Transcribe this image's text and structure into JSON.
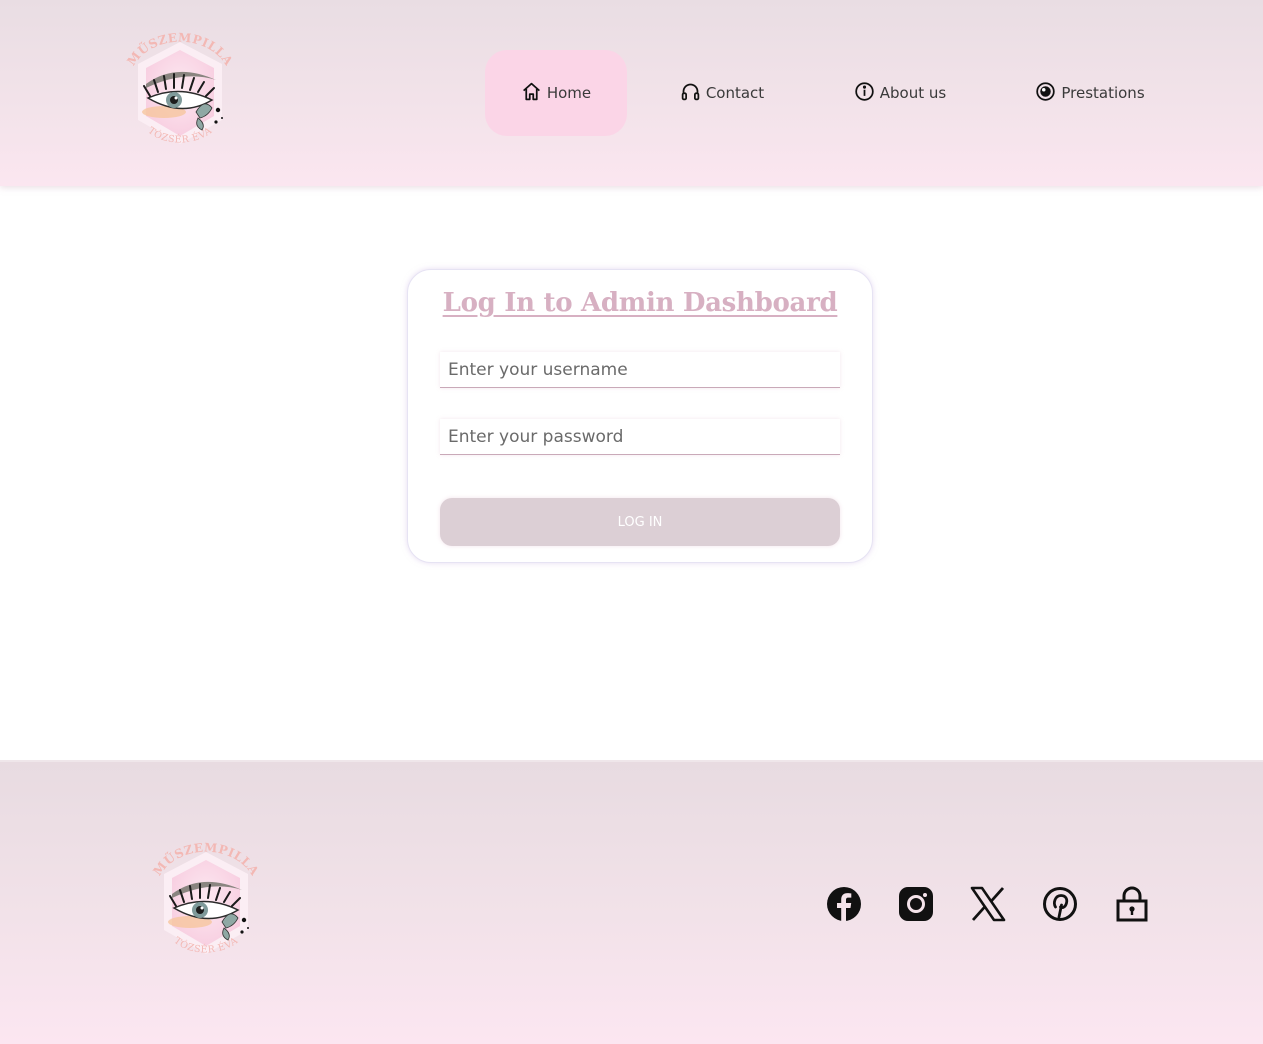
{
  "header": {
    "logo": {
      "name": "MŰSZEMPILLA",
      "owner": "TÓZSÉR ÉVA"
    },
    "nav": [
      {
        "label": "Home",
        "icon": "home-icon",
        "active": true
      },
      {
        "label": "Contact",
        "icon": "headset-icon",
        "active": false
      },
      {
        "label": "About us",
        "icon": "info-icon",
        "active": false
      },
      {
        "label": "Prestations",
        "icon": "eye-circle-icon",
        "active": false
      }
    ]
  },
  "login": {
    "title": "Log In to Admin Dashboard",
    "username_placeholder": "Enter your username",
    "password_placeholder": "Enter your password",
    "button_label": "LOG IN"
  },
  "footer": {
    "logo": {
      "name": "MŰSZEMPILLA",
      "owner": "TÓZSÉR ÉVA"
    },
    "social": [
      {
        "icon": "facebook-icon"
      },
      {
        "icon": "instagram-icon"
      },
      {
        "icon": "x-twitter-icon"
      },
      {
        "icon": "pinterest-icon"
      },
      {
        "icon": "lock-icon"
      }
    ]
  },
  "colors": {
    "accent_pink": "#fbd5e7",
    "title_pink": "#d7b0c2",
    "button_bg": "#dccfd5",
    "header_gradient_top": "#e9dde3",
    "header_gradient_bottom": "#fbe6f0"
  }
}
